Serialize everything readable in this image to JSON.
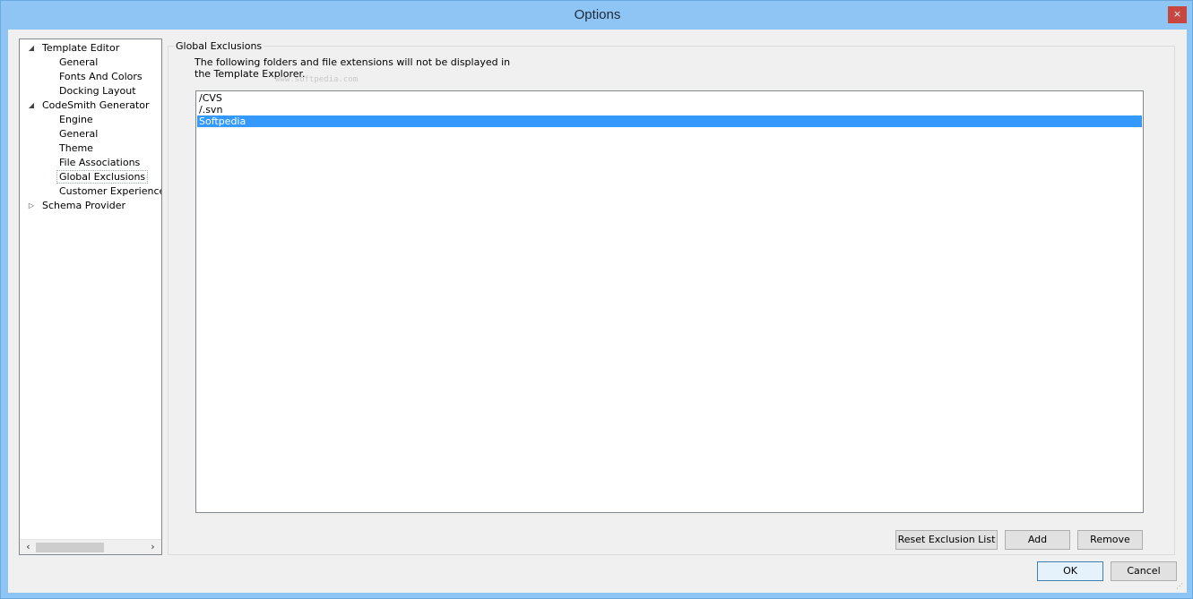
{
  "window": {
    "title": "Options",
    "close_glyph": "×"
  },
  "tree": {
    "items": [
      {
        "label": "Template Editor",
        "expanded": true,
        "level": 0
      },
      {
        "label": "General",
        "level": 1
      },
      {
        "label": "Fonts And Colors",
        "level": 1
      },
      {
        "label": "Docking Layout",
        "level": 1
      },
      {
        "label": "CodeSmith Generator",
        "expanded": true,
        "level": 0
      },
      {
        "label": "Engine",
        "level": 1
      },
      {
        "label": "General",
        "level": 1
      },
      {
        "label": "Theme",
        "level": 1
      },
      {
        "label": "File Associations",
        "level": 1
      },
      {
        "label": "Global Exclusions",
        "level": 1,
        "selected": true
      },
      {
        "label": "Customer Experience Im",
        "level": 1
      },
      {
        "label": "Schema Provider",
        "expanded": false,
        "level": 0
      }
    ],
    "expanded_glyph": "◢",
    "collapsed_glyph": "▷",
    "scroll_left": "‹",
    "scroll_right": "›"
  },
  "panel": {
    "group_title": "Global Exclusions",
    "description": "The following folders and file extensions will not be displayed in the Template Explorer.",
    "watermark": "www.softpedia.com",
    "exclusions": [
      {
        "value": "/CVS",
        "selected": false
      },
      {
        "value": "/.svn",
        "selected": false
      },
      {
        "value": "Softpedia",
        "selected": true
      }
    ],
    "buttons": {
      "reset": "Reset Exclusion List",
      "add": "Add",
      "remove": "Remove"
    }
  },
  "footer": {
    "ok": "OK",
    "cancel": "Cancel"
  },
  "colors": {
    "selection": "#3399ff",
    "titlebar": "#8ec5f5",
    "close": "#c7463f"
  }
}
